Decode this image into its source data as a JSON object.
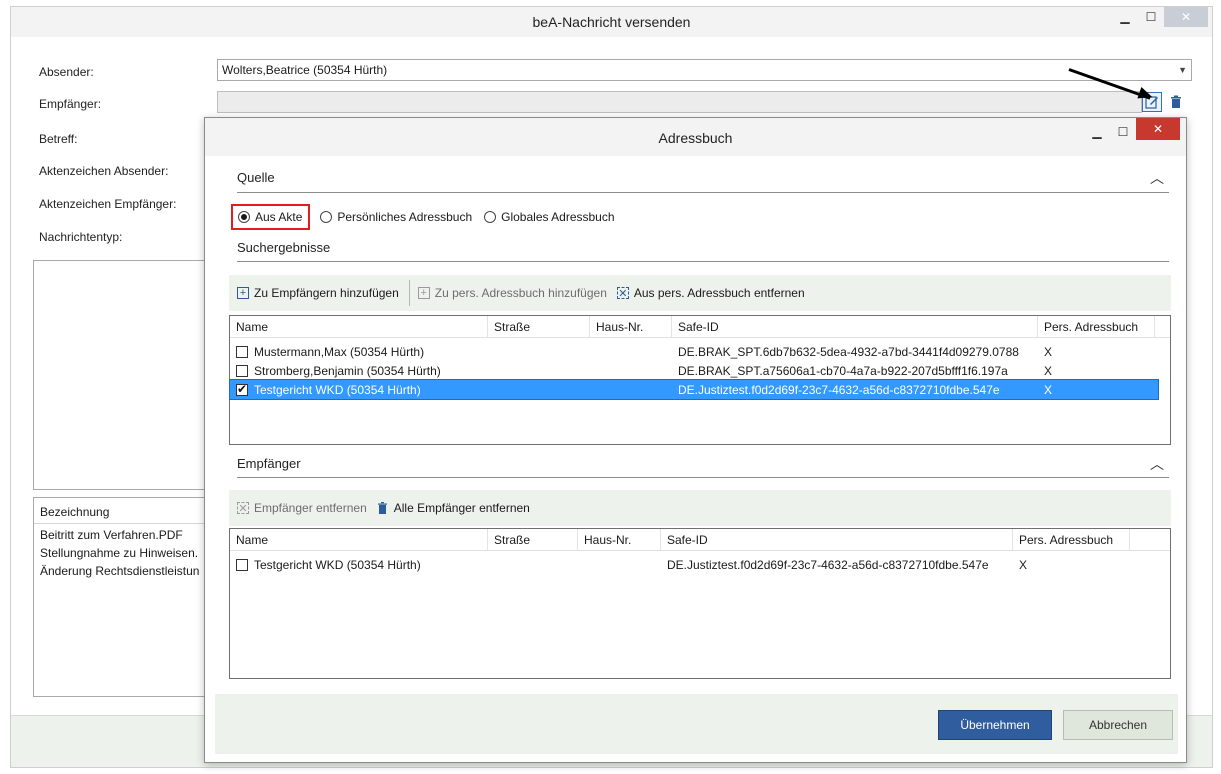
{
  "outer": {
    "title": "beA-Nachricht versenden",
    "labels": {
      "absender": "Absender:",
      "empfaenger": "Empfänger:",
      "betreff": "Betreff:",
      "az_absender": "Aktenzeichen Absender:",
      "az_empfaenger": "Aktenzeichen Empfänger:",
      "nachrichtentyp": "Nachrichtentyp:"
    },
    "sender_value": "Wolters,Beatrice (50354 Hürth)",
    "attachments": {
      "header": "Bezeichnung",
      "rows": [
        "Beitritt zum Verfahren.PDF",
        "Stellungnahme zu Hinweisen.",
        "Änderung Rechtsdienstleistun"
      ]
    }
  },
  "dialog": {
    "title": "Adressbuch",
    "quelle": {
      "title": "Quelle",
      "options": [
        "Aus Akte",
        "Persönliches Adressbuch",
        "Globales Adressbuch"
      ],
      "selected": "Aus Akte"
    },
    "results": {
      "title": "Suchergebnisse",
      "toolbar": {
        "add_recipients": "Zu Empfängern hinzufügen",
        "add_personal": "Zu pers. Adressbuch hinzufügen",
        "remove_personal": "Aus pers. Adressbuch entfernen"
      },
      "columns": [
        "Name",
        "Straße",
        "Haus-Nr.",
        "Safe-ID",
        "Pers. Adressbuch"
      ],
      "rows": [
        {
          "name": "Mustermann,Max (50354 Hürth)",
          "strasse": "",
          "hausnr": "",
          "safe_id": "DE.BRAK_SPT.6db7b632-5dea-4932-a7bd-3441f4d09279.0788",
          "pers": "X",
          "checked": false
        },
        {
          "name": "Stromberg,Benjamin (50354 Hürth)",
          "strasse": "",
          "hausnr": "",
          "safe_id": "DE.BRAK_SPT.a75606a1-cb70-4a7a-b922-207d5bfff1f6.197a",
          "pers": "X",
          "checked": false
        },
        {
          "name": "Testgericht WKD (50354 Hürth)",
          "strasse": "",
          "hausnr": "",
          "safe_id": "DE.Justiztest.f0d2d69f-23c7-4632-a56d-c8372710fdbe.547e",
          "pers": "X",
          "checked": true
        }
      ]
    },
    "recipients": {
      "title": "Empfänger",
      "toolbar": {
        "remove": "Empfänger entfernen",
        "remove_all": "Alle Empfänger entfernen"
      },
      "columns": [
        "Name",
        "Straße",
        "Haus-Nr.",
        "Safe-ID",
        "Pers. Adressbuch"
      ],
      "rows": [
        {
          "name": "Testgericht WKD (50354 Hürth)",
          "strasse": "",
          "hausnr": "",
          "safe_id": "DE.Justiztest.f0d2d69f-23c7-4632-a56d-c8372710fdbe.547e",
          "pers": "X",
          "checked": false
        }
      ]
    },
    "buttons": {
      "accept": "Übernehmen",
      "cancel": "Abbrechen"
    }
  },
  "colors": {
    "selection": "#3399ff",
    "primary_button": "#2f5d9e",
    "highlight_box": "#e02020",
    "toolbar_bg": "#eef2ec"
  }
}
